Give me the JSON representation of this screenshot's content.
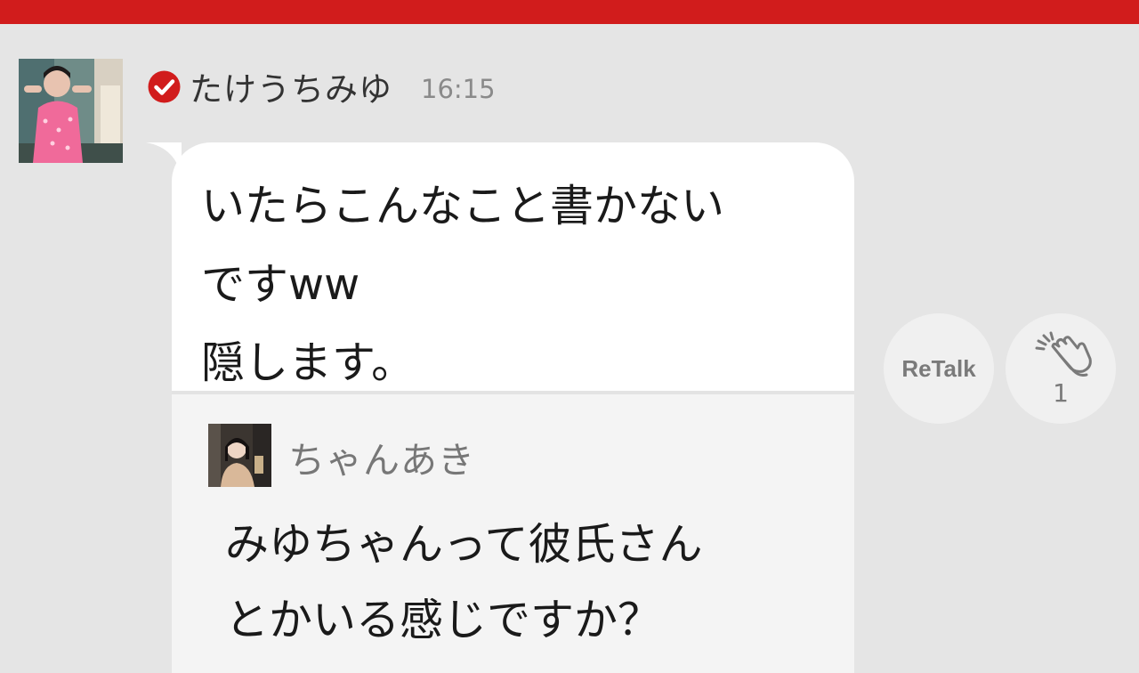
{
  "post": {
    "username": "たけうちみゆ",
    "time": "16:15",
    "message": "いたらこんなこと書かない\nですww\n隠します。"
  },
  "quote": {
    "username": "ちゃんあき",
    "message": "みゆちゃんって彼氏さん\nとかいる感じですか？"
  },
  "actions": {
    "retalk_label": "ReTalk",
    "clap_count": "1"
  },
  "colors": {
    "topbar": "#d11c1c",
    "verified_badge": "#d11c1c",
    "background": "#e5e5e5"
  },
  "icons": {
    "verified": "verified-check-icon",
    "clap": "clap-hands-icon"
  }
}
